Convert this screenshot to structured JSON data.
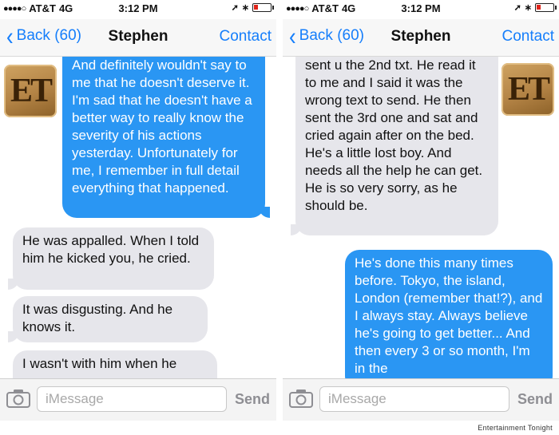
{
  "screens": [
    {
      "status": {
        "carrier": "AT&T",
        "network": "4G",
        "time": "3:12 PM"
      },
      "nav": {
        "back_label": "Back (60)",
        "title": "Stephen",
        "contact_label": "Contact"
      },
      "messages": [
        {
          "dir": "out",
          "text": "And definitely wouldn't say to me that he doesn't deserve it. I'm sad that he doesn't have a better way to really know the severity of his actions yesterday. Unfortunately for me, I remember in full detail everything that happened."
        },
        {
          "dir": "in",
          "text": "He was appalled. When I told him he kicked you, he cried."
        },
        {
          "dir": "in",
          "text": "It was disgusting. And he knows it."
        },
        {
          "dir": "in",
          "text": "I wasn't with him when he"
        }
      ],
      "composer": {
        "placeholder": "iMessage",
        "send_label": "Send"
      }
    },
    {
      "status": {
        "carrier": "AT&T",
        "network": "4G",
        "time": "3:12 PM"
      },
      "nav": {
        "back_label": "Back (60)",
        "title": "Stephen",
        "contact_label": "Contact"
      },
      "messages": [
        {
          "dir": "in",
          "text": "sent u the 2nd txt. He read it to me and I said it was the wrong text to send. He then sent the 3rd one and sat and cried again after on the bed. He's a little lost boy. And needs all the help he can get. He is so very sorry, as he should be."
        },
        {
          "dir": "out",
          "text": "He's done this many times before. Tokyo, the island, London (remember that!?), and I always stay. Always believe he's going to get better... And then every 3 or so month,  I'm in the"
        }
      ],
      "composer": {
        "placeholder": "iMessage",
        "send_label": "Send"
      }
    }
  ],
  "logo_text": "ET",
  "watermark": "Entertainment Tonight",
  "colors": {
    "ios_blue": "#157efb",
    "outgoing_bubble": "#2a96f3",
    "incoming_bubble": "#e6e6eb",
    "logo_gold": "#b38345"
  }
}
